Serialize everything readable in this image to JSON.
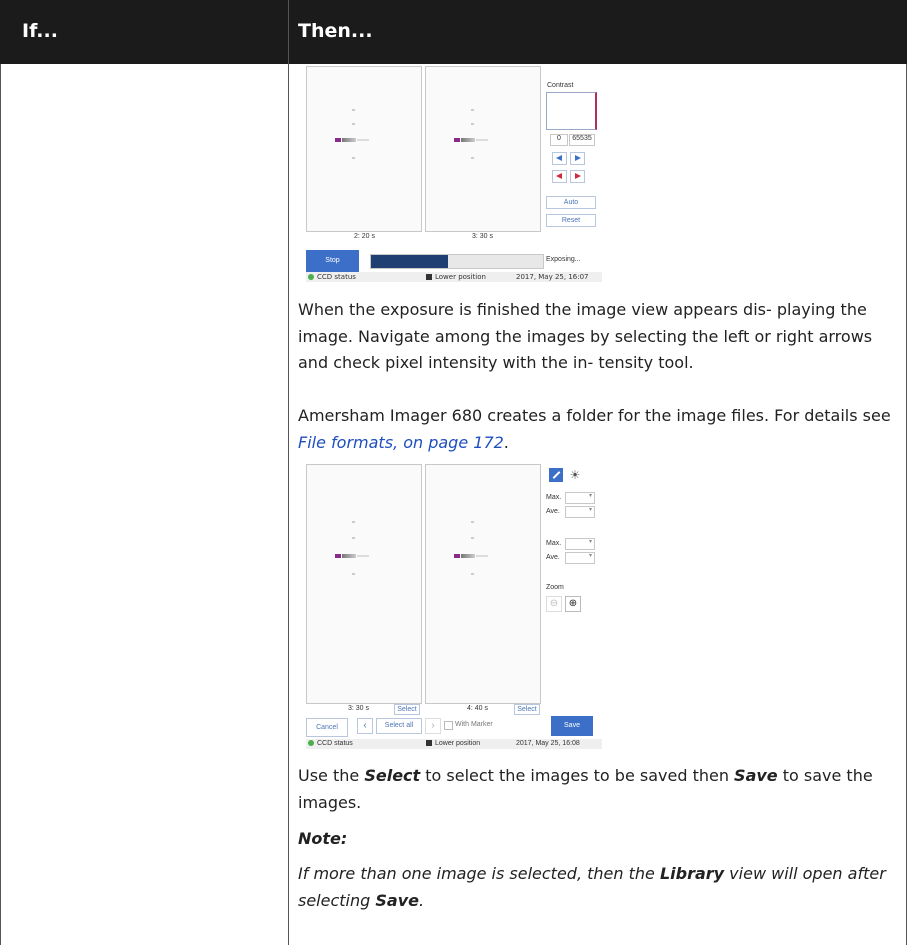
{
  "table": {
    "col_if": "If...",
    "col_then": "Then..."
  },
  "shot1": {
    "contrast_label": "Contrast",
    "contrast_min": "0",
    "contrast_max": "65535",
    "auto_label": "Auto",
    "reset_label": "Reset",
    "img1_caption": "2: 20 s",
    "img2_caption": "3: 30 s",
    "stop_label": "Stop",
    "exposing_label": "Exposing...",
    "progress": 0.45,
    "ccd_status": "CCD status",
    "position": "Lower position",
    "timestamp": "2017, May 25, 16:07"
  },
  "para1": "When the exposure is finished the image view appears dis- playing the image. Navigate among the images by selecting the left or right arrows and check pixel intensity with the in- tensity tool.",
  "para2_text": "Amersham Imager 680 creates a folder for the image files. For details see ",
  "para2_link": "File formats, on page 172",
  "para2_end": ".",
  "shot2": {
    "max_label": "Max.",
    "ave_label": "Ave.",
    "zoom_label": "Zoom",
    "img1_caption": "3: 30 s",
    "img2_caption": "4: 40 s",
    "select_label": "Select",
    "cancel_label": "Cancel",
    "select_all_label": "Select all",
    "with_marker_label": "With Marker",
    "save_label": "Save",
    "ccd_status": "CCD status",
    "position": "Lower position",
    "timestamp": "2017, May 25, 16:08"
  },
  "para3": {
    "t1": "Use the ",
    "b1": "Select",
    "t2": " to select the images to be saved then ",
    "b2": "Save",
    "t3": " to save the images."
  },
  "note": {
    "heading": "Note:",
    "t1": "If more than one image is selected, then the ",
    "b1": "Library",
    "t2": " view will open after selecting ",
    "b2": "Save",
    "t3": "."
  },
  "colors": {
    "header_bg": "#1b1b1b",
    "accent_blue": "#3c6fc7",
    "link": "#1f4fbf"
  }
}
